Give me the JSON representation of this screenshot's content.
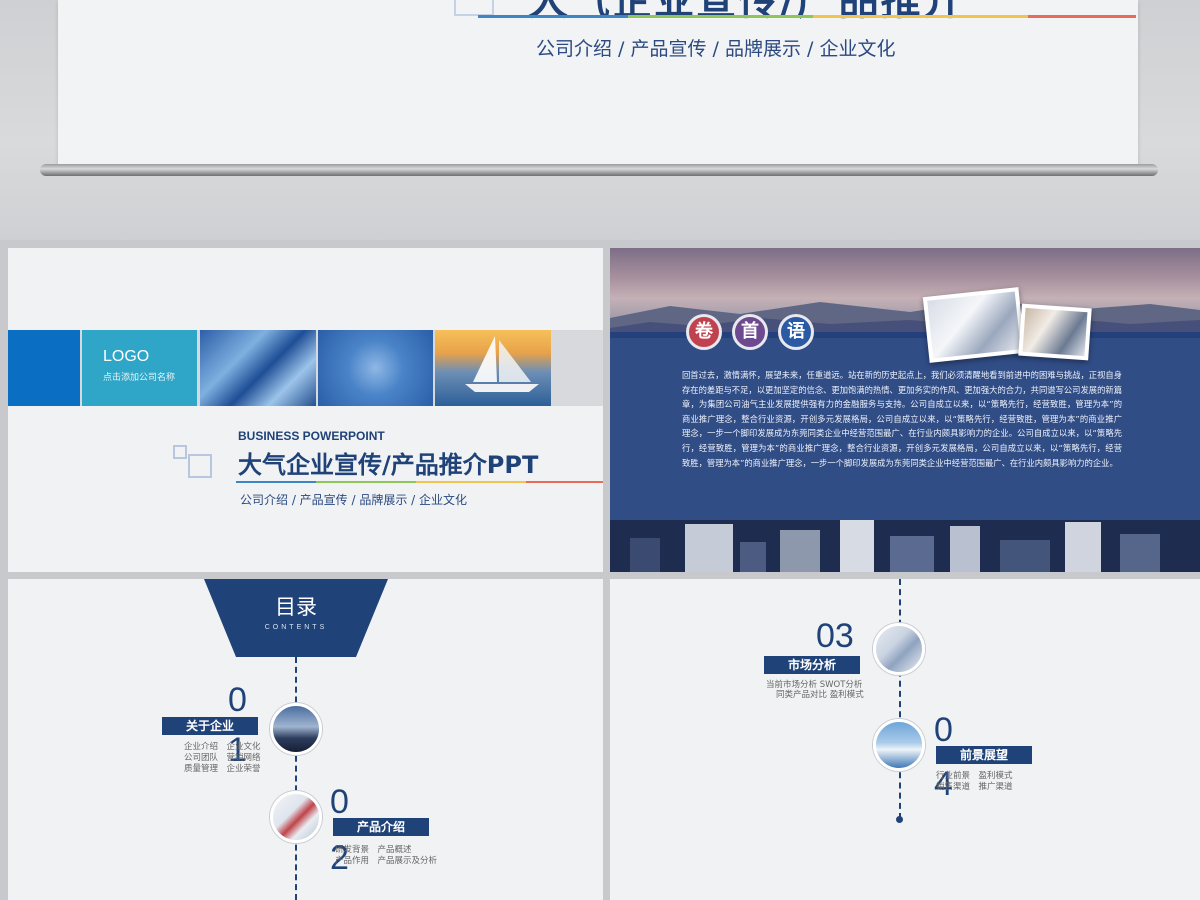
{
  "hero": {
    "title_fragment": "大气企业宣传/产品推介",
    "subtitle": "公司介绍 / 产品宣传 / 品牌展示 / 企业文化"
  },
  "slide1": {
    "logo": "LOGO",
    "logo_sub": "点击添加公司名称",
    "eyebrow": "BUSINESS POWERPOINT",
    "title": "大气企业宣传/产品推介PPT",
    "subtitle": "公司介绍 / 产品宣传 / 品牌展示 / 企业文化"
  },
  "slide2": {
    "heading": [
      "卷",
      "首",
      "语"
    ],
    "body": "回首过去，激情满怀，展望未来，任重道远。站在新的历史起点上，我们必须清醒地看到前进中的困难与挑战，正视自身存在的差距与不足，以更加坚定的信念、更加饱满的热情、更加务实的作风、更加强大的合力，共同谱写公司发展的新篇章，为集团公司油气主业发展提供强有力的金融服务与支持。公司自成立以来，以“策略先行，经营致胜，管理为本”的商业推广理念，整合行业资源，开创多元发展格局，公司自成立以来，以“策略先行，经营致胜，管理为本”的商业推广理念，一步一个脚印发展成为东莞同类企业中经营范围最广、在行业内颇具影响力的企业。公司自成立以来，以“策略先行，经营致胜，管理为本”的商业推广理念，整合行业资源，开创多元发展格局，公司自成立以来，以“策略先行，经营致胜，管理为本”的商业推广理念，一步一个脚印发展成为东莞同类企业中经营范围最广、在行业内颇具影响力的企业。"
  },
  "slide3": {
    "toc_title": "目录",
    "toc_sub": "CONTENTS",
    "items": [
      {
        "num_a": "0",
        "num_b": "1",
        "label": "关于企业",
        "desc": [
          "企业介绍　企业文化",
          "公司团队　营销网络",
          "质量管理　企业荣誉"
        ]
      },
      {
        "num_a": "0",
        "num_b": "2",
        "label": "产品介绍",
        "desc": [
          "研发背景　产品概述",
          "产品作用　产品展示及分析"
        ]
      }
    ]
  },
  "slide4": {
    "items": [
      {
        "num": "03",
        "label": "市场分析",
        "desc": [
          "当前市场分析 SWOT分析",
          "同类产品对比 盈利模式"
        ]
      },
      {
        "num_a": "0",
        "num_b": "4",
        "label": "前景展望",
        "desc": [
          "行业前景　盈利模式",
          "销售渠道　推广渠道"
        ]
      }
    ]
  },
  "colors": {
    "navy": "#1f4278",
    "accent_blue": "#0a6fc2",
    "teal": "#2fa6c7",
    "line_blue": "#3d86c6",
    "line_green": "#8fc65a",
    "line_yellow": "#f1c44e",
    "line_red": "#e96b5a"
  }
}
